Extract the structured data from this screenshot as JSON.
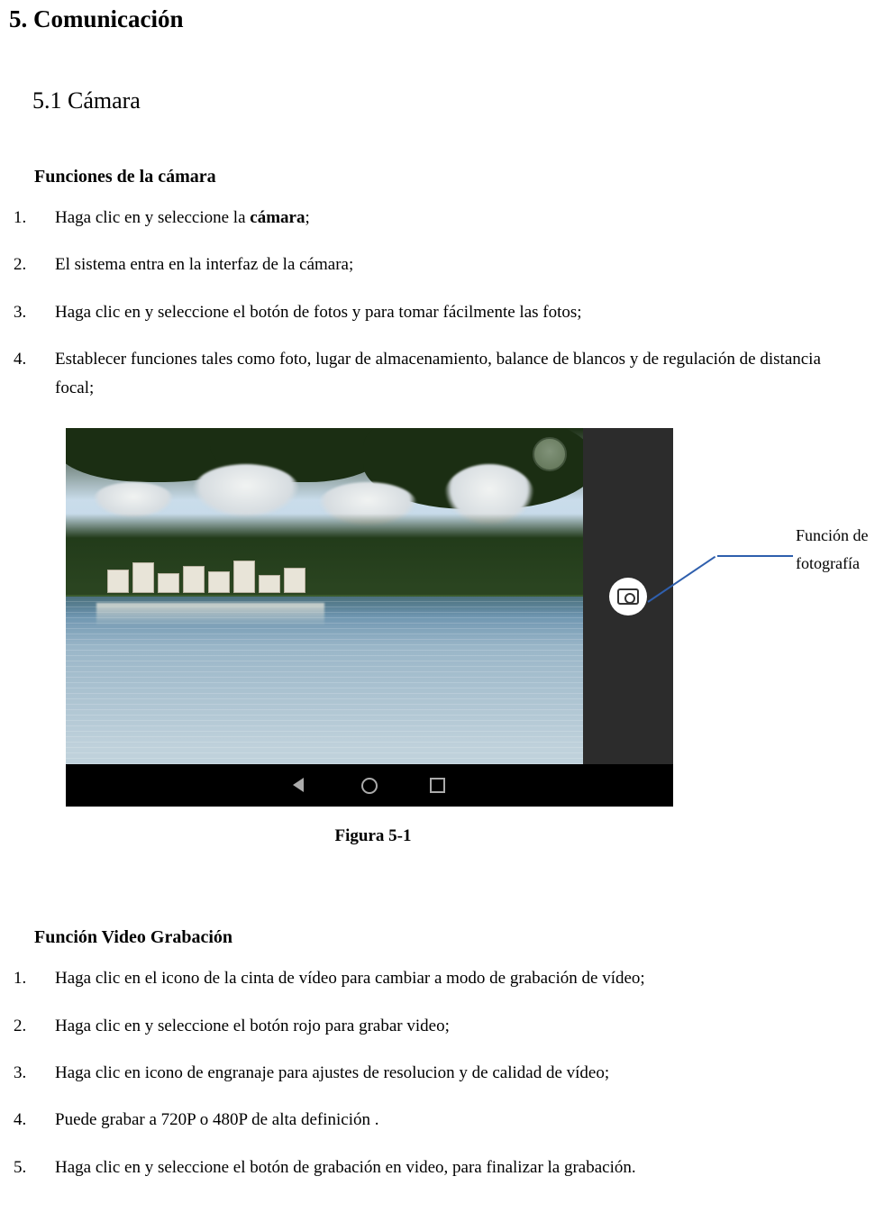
{
  "section": {
    "heading": "5. Comunicación",
    "subheading": "5.1 Cámara"
  },
  "camera_block": {
    "title": "Funciones de la cámara",
    "steps": [
      {
        "pre": "Haga clic en y seleccione la ",
        "bold": "cámara",
        "post": ";"
      },
      {
        "text": "El sistema entra en la interfaz de la cámara;"
      },
      {
        "text": "Haga clic en y seleccione el botón de fotos y para tomar fácilmente las fotos;"
      },
      {
        "text": "Establecer funciones tales como foto, lugar de almacenamiento, balance de blancos y de regulación de distancia focal;"
      }
    ]
  },
  "figure": {
    "caption": "Figura 5-1",
    "callout_line1": "Función de",
    "callout_line2": "fotografía",
    "icons": {
      "shutter": "shutter-button",
      "camera": "camera-icon",
      "gallery": "gallery-thumbnail",
      "back": "nav-back-icon",
      "home": "nav-home-icon",
      "recent": "nav-recent-icon"
    }
  },
  "video_block": {
    "title": "Función Video Grabación",
    "steps": [
      "Haga clic en el icono de la cinta de vídeo para cambiar a modo de grabación de vídeo;",
      "Haga clic en y seleccione el botón rojo para grabar video;",
      "Haga clic en icono de engranaje para ajustes de resolucion y de calidad de vídeo;",
      "Puede grabar a 720P o 480P de alta definición .",
      "Haga clic en y seleccione el botón de grabación en video, para finalizar la grabación."
    ]
  }
}
